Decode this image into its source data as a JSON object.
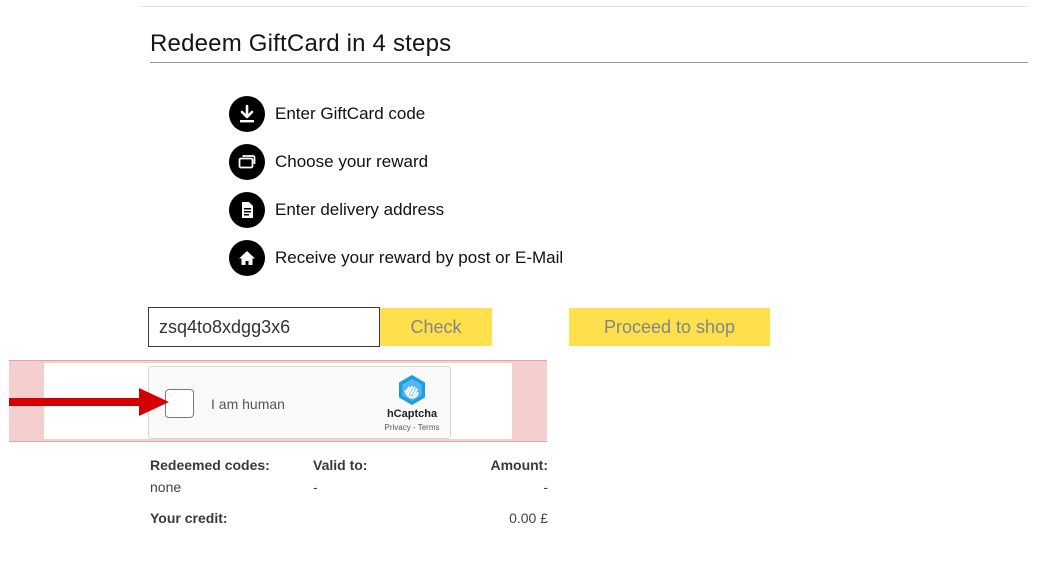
{
  "page": {
    "title": "Redeem GiftCard in 4 steps"
  },
  "steps": [
    {
      "icon": "download-icon",
      "label": "Enter GiftCard code"
    },
    {
      "icon": "cards-icon",
      "label": "Choose your reward"
    },
    {
      "icon": "document-icon",
      "label": "Enter delivery address"
    },
    {
      "icon": "home-icon",
      "label": "Receive your reward by post or E-Mail"
    }
  ],
  "form": {
    "code_value": "zsq4to8xdgg3x6",
    "check_label": "Check",
    "shop_label": "Proceed to shop"
  },
  "captcha": {
    "label": "I am human",
    "brand": "hCaptcha",
    "privacy": "Privacy",
    "separator": " - ",
    "terms": "Terms"
  },
  "summary": {
    "redeemed_label": "Redeemed codes:",
    "valid_label": "Valid to:",
    "amount_label": "Amount:",
    "redeemed_value": "none",
    "valid_value": "-",
    "amount_value": "-",
    "credit_label": "Your credit:",
    "credit_value": "0.00 £"
  },
  "colors": {
    "button_yellow": "#fde04b",
    "button_text": "#858585",
    "highlight_band": "#f5cfcf",
    "arrow_red": "#d40000",
    "icon_circle": "#000000"
  }
}
